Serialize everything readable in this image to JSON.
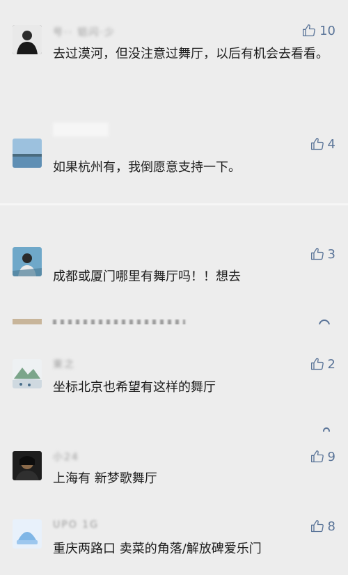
{
  "colors": {
    "background": "#ededed",
    "like_blue": "#5a7498",
    "text": "#1c1c1c"
  },
  "comments": [
    {
      "name": "号·· 铝闪·少",
      "text": "去过漠河，但没注意过舞厅，以后有机会去看看。",
      "likes": "10",
      "avatar": "person-dark-suit"
    },
    {
      "name": "",
      "text": "如果杭州有，我倒愿意支持一下。",
      "likes": "4",
      "avatar": "lake-landscape"
    },
    {
      "name": "",
      "text": "成都或厦门哪里有舞厅吗！！想去",
      "likes": "3",
      "avatar": "child-on-rocks"
    },
    {
      "name": "東之",
      "text": "坐标北京也希望有这样的舞厅",
      "likes": "2",
      "avatar": "snow-mountain-painting"
    },
    {
      "name": "小24",
      "text": "上海有 新梦歌舞厅",
      "likes": "9",
      "avatar": "dark-portrait"
    },
    {
      "name": "UPO 1G",
      "text": "重庆两路口 卖菜的角落/解放碑爱乐门",
      "likes": "8",
      "avatar": "blue-sky-object"
    }
  ]
}
